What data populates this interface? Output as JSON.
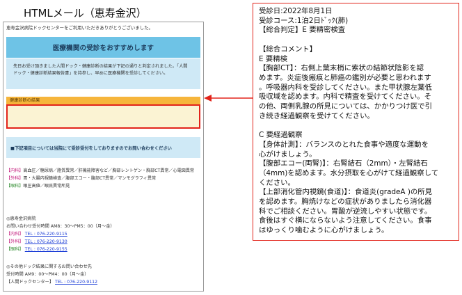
{
  "page_title": "HTMLメール（恵寿金沢）",
  "email": {
    "intro": "恵寿金沢病院ドックセンターをご利用いただきありがとうございました。",
    "rec_title": "医療機関の受診をおすすめします",
    "rec_body_1": "先日お受け頂きました人間ドック・健康診断の結果が下記の通りと判定されました。「人間",
    "rec_body_2": "ドック・健康診断結果報告書」を持参し、早めに医療機関を受診してください。",
    "result_header": "健康診断の結果",
    "notice": "■下記項目については当院にて受診受付をしておりますのでお問い合わせください",
    "departments": [
      {
        "dept": "【内科】",
        "text": "高血圧／糖尿病／脂質異常／肝機能障害など／胸部レントゲン・胸部CT異常／心電図異常",
        "color": "#c2187a"
      },
      {
        "dept": "【外科】",
        "text": "胃・大腸内視鏡検査／腹部エコー・腹部CT異常／マンモグラフィ異常",
        "color": "#c2187a"
      },
      {
        "dept": "【眼科】",
        "text": "眼圧高値／眼底異常所見",
        "color": "#2e8b2e"
      }
    ],
    "contact_title": "◎恵寿金沢病院",
    "contact_hours": "お問い合わせ受付時間 AM8：30〜PM5：00（月〜金）",
    "contact_tels": [
      {
        "dept": "【内科】",
        "tel": "TEL : 076-220-9115",
        "color": "#c2187a"
      },
      {
        "dept": "【外科】",
        "tel": "TEL : 076-220-9130",
        "color": "#c2187a"
      },
      {
        "dept": "【眼科】",
        "tel": "TEL : 076-220-9155",
        "color": "#2e8b2e"
      }
    ],
    "other_title": "◎その他ドック結果に関するお問い合わせ先",
    "other_hours": "受付時間 AM9：00〜PM4：00（月〜金）",
    "other_dept": "【人間ドックセンター】",
    "other_tel": "TEL : 076-220-9112"
  },
  "callout": {
    "lines": [
      "受診日:2022年8月1日",
      "受診コース:1泊2日ﾄﾞｯｸ(肺)",
      "【総合判定】E 要精密検査",
      "",
      "【総合コメント】",
      "E 要精検",
      "【胸部CT】：右側上葉末梢に索状の結節状陰影を認",
      "めます。炎症後瘢痕と肺癌の鑑別が必要と思われます",
      "。呼吸器内科を受診してください。また甲状腺左葉低",
      "吸収域を認めます。内科で精査を受けてください。そ",
      "の他、両側乳腺の所見については、かかりつけ医で引",
      "き続き経過観察を受けてください。",
      "",
      "C 要経過観察",
      "【身体計測】：バランスのとれた食事や適度な運動を",
      "心がけましょう。",
      "【腹部エコー(両腎)】：右腎結石（2mm）・左腎結石",
      "（4mm)を認めます。水分摂取を心がけて経過観察して",
      "ください。",
      "【上部消化管内視鏡(食道)】：食道炎(gradeA )の所見",
      "を認めます。胸焼けなどの症状がありましたら消化器",
      "科でご相談ください。胃酸が逆流しやすい状態です。",
      "食後はすぐ横にならないよう注意してください。食事",
      "はゆっくり噛むように心がけましょう。"
    ]
  },
  "colors": {
    "banner_blue": "#6ec3e6",
    "light_blue": "#cfe9f6",
    "orange": "#f6b53b",
    "highlight_red": "#e2231a",
    "link_blue": "#1a3cd6"
  }
}
